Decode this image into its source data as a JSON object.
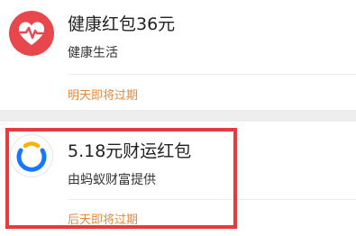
{
  "items": [
    {
      "icon": "heart-pulse-icon",
      "title": "健康红包36元",
      "subtitle": "健康生活",
      "expiry": "明天即将过期"
    },
    {
      "icon": "ant-fortune-logo-icon",
      "title": "5.18元财运红包",
      "subtitle": "由蚂蚁财富提供",
      "expiry": "后天即将过期"
    }
  ],
  "colors": {
    "accent_orange": "#e8883a",
    "health_red": "#e8474e",
    "highlight_red": "#e83a3a",
    "ant_blue": "#1677ff",
    "ant_yellow": "#f5b400"
  }
}
